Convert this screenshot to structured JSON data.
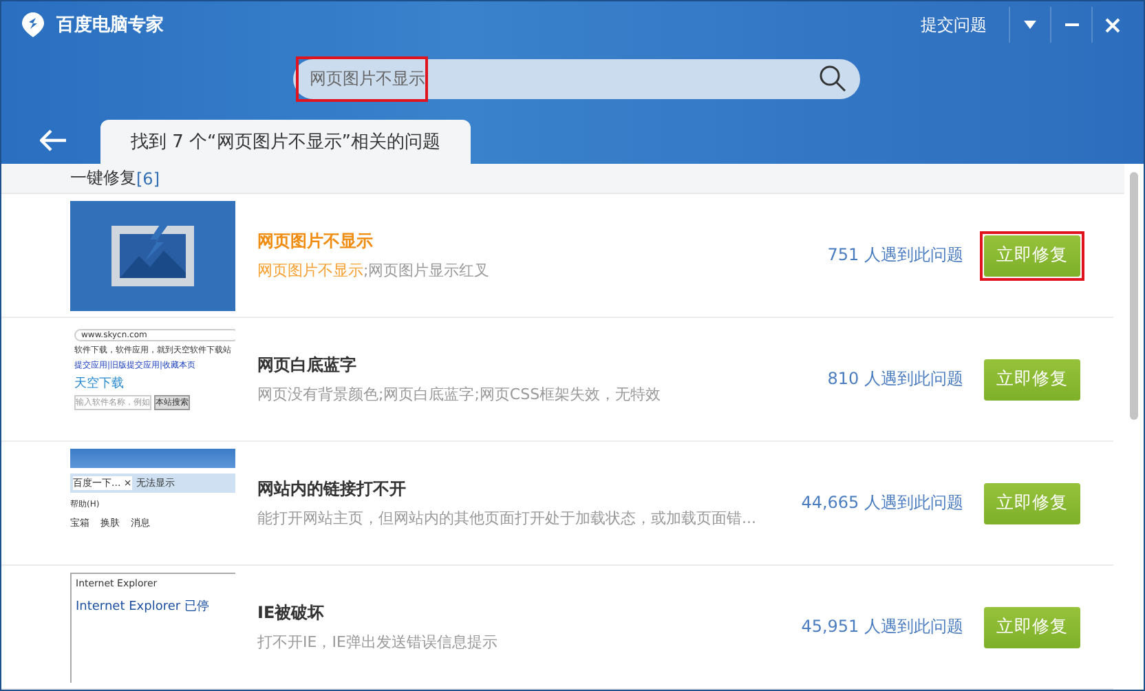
{
  "window": {
    "title": "百度电脑专家",
    "submit_link": "提交问题"
  },
  "search": {
    "value": "网页图片不显示",
    "highlighted": true
  },
  "tab": {
    "label": "找到 7 个“网页图片不显示”相关的问题",
    "selected": true
  },
  "section": {
    "title": "一键修复",
    "count": "[6]"
  },
  "results": [
    {
      "thumb": {
        "kind": "image-icon"
      },
      "title": "网页图片不显示",
      "active": true,
      "match": "网页图片不显示",
      "desc": ";网页图片显示红叉",
      "count": "751 人遇到此问题",
      "button": "立即修复",
      "highlighted": true
    },
    {
      "thumb": {
        "kind": "site",
        "texts": [
          "www.skycn.com",
          "软件下载，软件应用，就到天空软件下载站",
          "提交应用|旧版提交应用|收藏本页",
          "天空下载",
          "输入软件名称，例如",
          "本站搜索"
        ]
      },
      "title": "网页白底蓝字",
      "active": false,
      "desc": "网页没有背景颜色;网页白底蓝字;网页CSS框架失效，无特效",
      "count": "810 人遇到此问题",
      "button": "立即修复",
      "highlighted": false
    },
    {
      "thumb": {
        "kind": "browser",
        "texts": [
          "百度一下...",
          "×",
          "无法显示",
          "帮助(H)",
          "宝箱",
          "换肤",
          "消息"
        ]
      },
      "title": "网站内的链接打不开",
      "active": false,
      "desc": "能打开网站主页，但网站内的其他页面打开处于加载状态，或加载页面错...",
      "count": "44,665 人遇到此问题",
      "button": "立即修复",
      "highlighted": false
    },
    {
      "thumb": {
        "kind": "dialog",
        "texts": [
          "Internet Explorer",
          "Internet Explorer 已停"
        ]
      },
      "title": "IE被破坏",
      "active": false,
      "desc": "打不开IE，IE弹出发送错误信息提示",
      "count": "45,951 人遇到此问题",
      "button": "立即修复",
      "highlighted": false
    }
  ]
}
